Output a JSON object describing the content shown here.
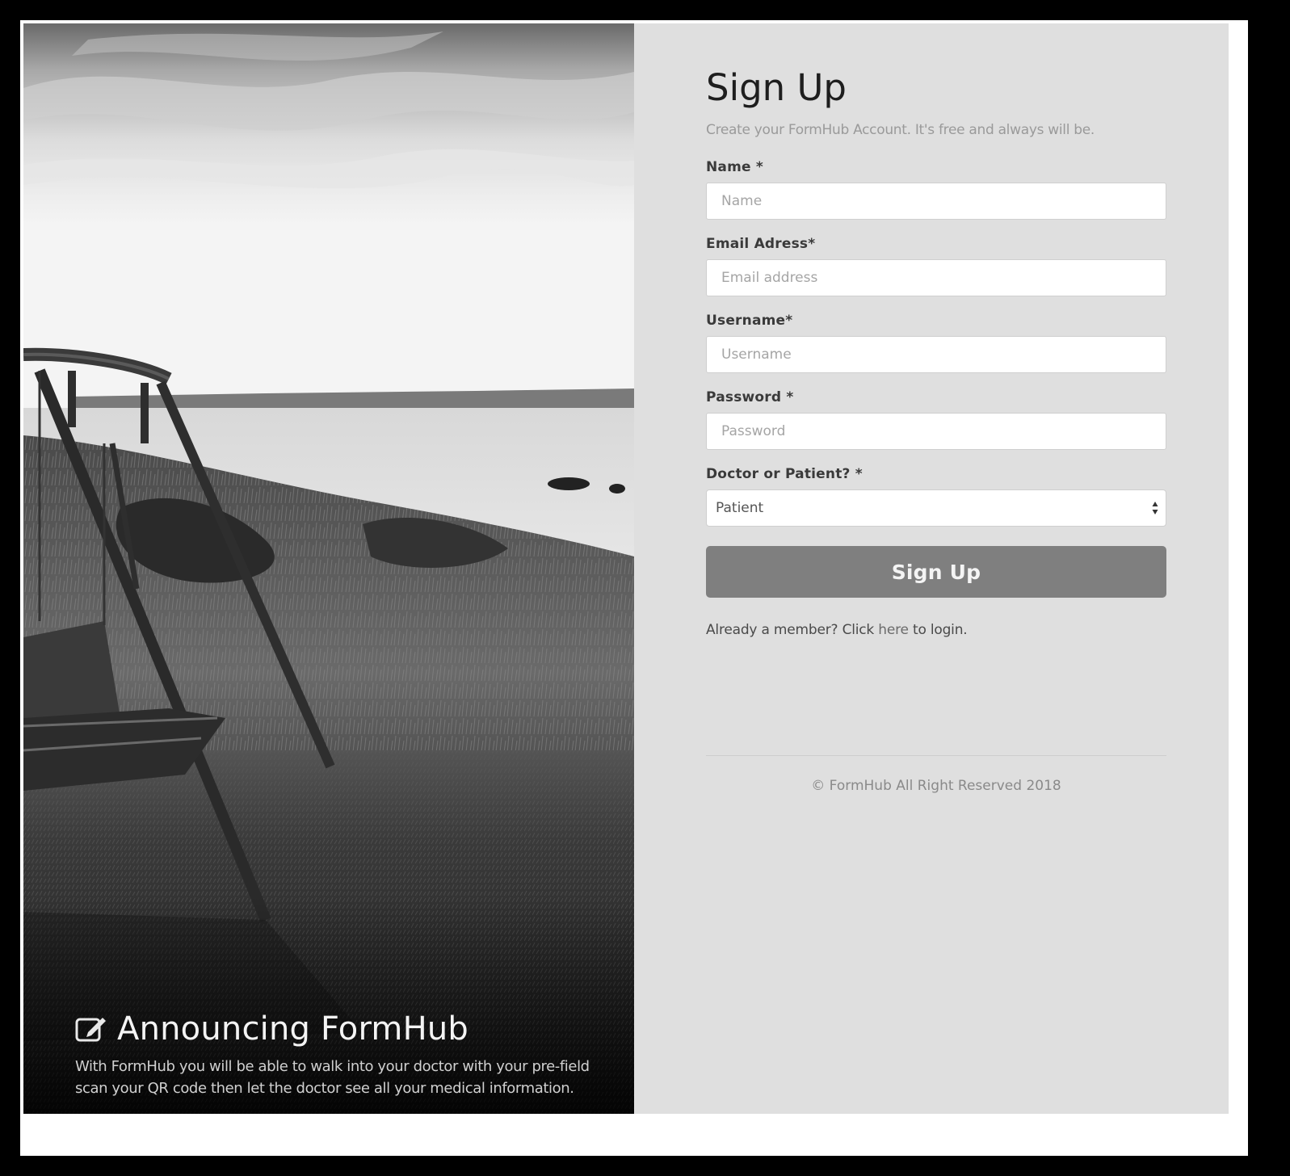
{
  "hero": {
    "title": "Announcing FormHub",
    "text_line_1": "With FormHub you will be able to walk into your doctor with your pre-field",
    "text_line_2": "scan your QR code then let the doctor see all your medical information.",
    "icon": "edit-icon"
  },
  "signup": {
    "title": "Sign Up",
    "subtitle": "Create your FormHub Account. It's free and always will be.",
    "fields": {
      "name": {
        "label": "Name *",
        "placeholder": "Name"
      },
      "email": {
        "label": "Email Adress*",
        "placeholder": "Email address"
      },
      "username": {
        "label": "Username*",
        "placeholder": "Username"
      },
      "password": {
        "label": "Password *",
        "placeholder": "Password"
      },
      "role": {
        "label": "Doctor or Patient? *",
        "selected": "Patient"
      }
    },
    "submit_label": "Sign Up",
    "login_prefix": "Already a member? Click ",
    "login_link": "here",
    "login_suffix": " to login."
  },
  "footer": {
    "copyright": "© FormHub All Right Reserved 2018"
  },
  "colors": {
    "panel_bg": "#dfdfdf",
    "button_bg": "#7f7f7f",
    "frame": "#ffffff",
    "outer": "#000000"
  }
}
